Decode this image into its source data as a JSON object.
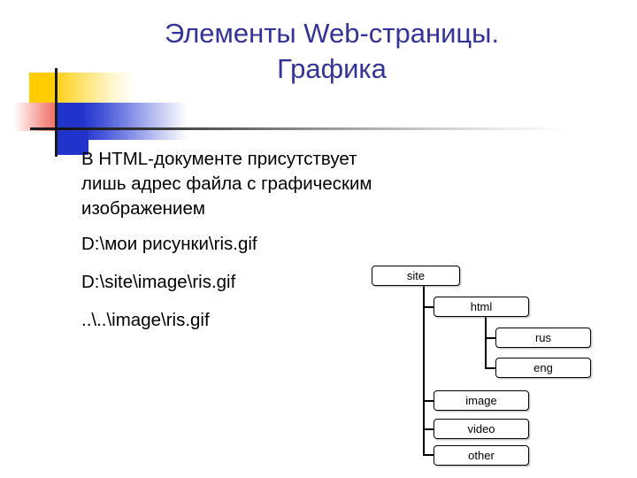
{
  "slide": {
    "title": "Элементы Web-страницы.\nГрафика",
    "title_color": "#333399",
    "body": {
      "paragraph": "В HTML-документе присутствует лишь адрес файла с графическим изображением",
      "paths": [
        "D:\\мои рисунки\\ris.gif",
        "D:\\site\\image\\ris.gif",
        "..\\..\\image\\ris.gif"
      ]
    },
    "decoration": {
      "yellow": "#ffcc00",
      "red": "#e8403c",
      "blue": "#2233cc",
      "line": "#1a1a1a"
    },
    "tree": {
      "nodes": [
        {
          "id": "site",
          "label": "site"
        },
        {
          "id": "html",
          "label": "html"
        },
        {
          "id": "rus",
          "label": "rus"
        },
        {
          "id": "eng",
          "label": "eng"
        },
        {
          "id": "image",
          "label": "image"
        },
        {
          "id": "video",
          "label": "video"
        },
        {
          "id": "other",
          "label": "other"
        }
      ]
    }
  }
}
